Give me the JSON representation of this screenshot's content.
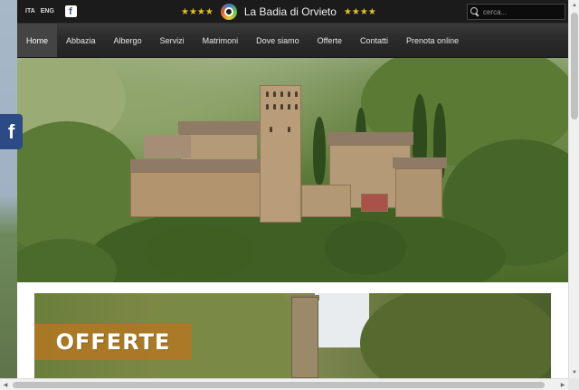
{
  "topbar": {
    "languages": [
      "ITA",
      "ENG"
    ],
    "facebook_icon": "facebook-icon",
    "stars_left": "★★★★",
    "stars_right": "★★★★",
    "site_name": "La Badia di Orvieto",
    "search": {
      "placeholder": "cerca..."
    }
  },
  "nav": {
    "items": [
      "Home",
      "Abbazia",
      "Albergo",
      "Servizi",
      "Matrimoni",
      "Dove siamo",
      "Offerte",
      "Contatti",
      "Prenota online"
    ],
    "active": "Home"
  },
  "banner": {
    "label": "OFFERTE"
  },
  "side": {
    "facebook_glyph": "f"
  },
  "colors": {
    "topbar": "#1b1b1b",
    "nav": "#2a2a2a",
    "stars": "#e2c12a",
    "banner_label": "#b07823",
    "facebook": "#2b4a86"
  }
}
